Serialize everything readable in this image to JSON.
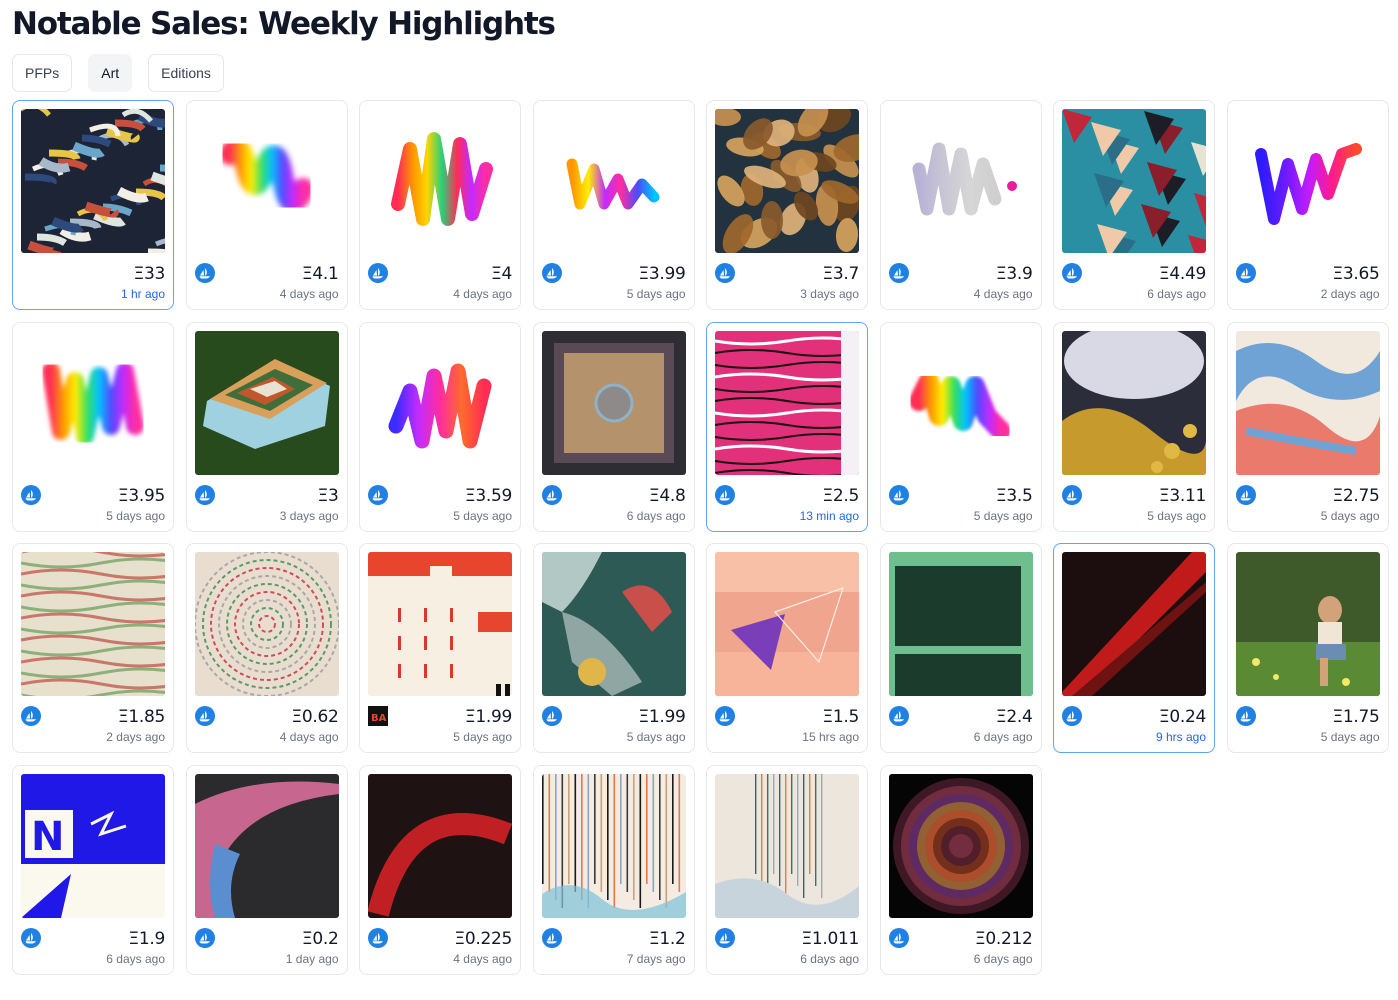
{
  "page": {
    "title": "Notable Sales: Weekly Highlights"
  },
  "tabs": [
    {
      "label": "PFPs",
      "active": false
    },
    {
      "label": "Art",
      "active": true
    },
    {
      "label": "Editions",
      "active": false
    }
  ],
  "colors": {
    "accent_border": "#60a5fa",
    "recent_time": "#2563eb",
    "opensea_blue": "#2081e2"
  },
  "currency_symbol": "Ξ",
  "sales": [
    {
      "price": "Ξ33",
      "time": "1 hr ago",
      "recent": true,
      "marketplace": "none",
      "art": "shapes"
    },
    {
      "price": "Ξ4.1",
      "time": "4 days ago",
      "recent": false,
      "marketplace": "opensea",
      "art": "squiggle-fuzzy"
    },
    {
      "price": "Ξ4",
      "time": "4 days ago",
      "recent": false,
      "marketplace": "opensea",
      "art": "squiggle-tall"
    },
    {
      "price": "Ξ3.99",
      "time": "5 days ago",
      "recent": false,
      "marketplace": "opensea",
      "art": "squiggle-small"
    },
    {
      "price": "Ξ3.7",
      "time": "3 days ago",
      "recent": false,
      "marketplace": "opensea",
      "art": "leaves"
    },
    {
      "price": "Ξ3.9",
      "time": "4 days ago",
      "recent": false,
      "marketplace": "opensea",
      "art": "squiggle-grey"
    },
    {
      "price": "Ξ4.49",
      "time": "6 days ago",
      "recent": false,
      "marketplace": "opensea",
      "art": "collage"
    },
    {
      "price": "Ξ3.65",
      "time": "2 days ago",
      "recent": false,
      "marketplace": "opensea",
      "art": "squiggle-violet"
    },
    {
      "price": "Ξ3.95",
      "time": "5 days ago",
      "recent": false,
      "marketplace": "opensea",
      "art": "squiggle-rainbow"
    },
    {
      "price": "Ξ3",
      "time": "3 days ago",
      "recent": false,
      "marketplace": "opensea",
      "art": "terrain"
    },
    {
      "price": "Ξ3.59",
      "time": "5 days ago",
      "recent": false,
      "marketplace": "opensea",
      "art": "squiggle-bold"
    },
    {
      "price": "Ξ4.8",
      "time": "6 days ago",
      "recent": false,
      "marketplace": "opensea",
      "art": "frame-circle"
    },
    {
      "price": "Ξ2.5",
      "time": "13 min ago",
      "recent": true,
      "marketplace": "opensea",
      "art": "pink-stripes"
    },
    {
      "price": "Ξ3.5",
      "time": "5 days ago",
      "recent": false,
      "marketplace": "opensea",
      "art": "squiggle-noise"
    },
    {
      "price": "Ξ3.11",
      "time": "5 days ago",
      "recent": false,
      "marketplace": "opensea",
      "art": "cloud-gold"
    },
    {
      "price": "Ξ2.75",
      "time": "5 days ago",
      "recent": false,
      "marketplace": "opensea",
      "art": "marble"
    },
    {
      "price": "Ξ1.85",
      "time": "2 days ago",
      "recent": false,
      "marketplace": "opensea",
      "art": "map-green"
    },
    {
      "price": "Ξ0.62",
      "time": "4 days ago",
      "recent": false,
      "marketplace": "opensea",
      "art": "map-swirl"
    },
    {
      "price": "Ξ1.99",
      "time": "5 days ago",
      "recent": false,
      "marketplace": "artblocks",
      "art": "building"
    },
    {
      "price": "Ξ1.99",
      "time": "5 days ago",
      "recent": false,
      "marketplace": "opensea",
      "art": "teal-abstract"
    },
    {
      "price": "Ξ1.5",
      "time": "15 hrs ago",
      "recent": false,
      "marketplace": "opensea",
      "art": "peach-triangle"
    },
    {
      "price": "Ξ2.4",
      "time": "6 days ago",
      "recent": false,
      "marketplace": "opensea",
      "art": "green-bands"
    },
    {
      "price": "Ξ0.24",
      "time": "9 hrs ago",
      "recent": true,
      "marketplace": "opensea",
      "art": "red-streak"
    },
    {
      "price": "Ξ1.75",
      "time": "5 days ago",
      "recent": false,
      "marketplace": "opensea",
      "art": "photo"
    },
    {
      "price": "Ξ1.9",
      "time": "6 days ago",
      "recent": false,
      "marketplace": "opensea",
      "art": "blue-letters"
    },
    {
      "price": "Ξ0.2",
      "time": "1 day ago",
      "recent": false,
      "marketplace": "opensea",
      "art": "pink-wave"
    },
    {
      "price": "Ξ0.225",
      "time": "4 days ago",
      "recent": false,
      "marketplace": "opensea",
      "art": "red-arc"
    },
    {
      "price": "Ξ1.2",
      "time": "7 days ago",
      "recent": false,
      "marketplace": "opensea",
      "art": "drip-lines"
    },
    {
      "price": "Ξ1.011",
      "time": "6 days ago",
      "recent": false,
      "marketplace": "opensea",
      "art": "drip-lines-light"
    },
    {
      "price": "Ξ0.212",
      "time": "6 days ago",
      "recent": false,
      "marketplace": "opensea",
      "art": "circle-dark"
    }
  ]
}
